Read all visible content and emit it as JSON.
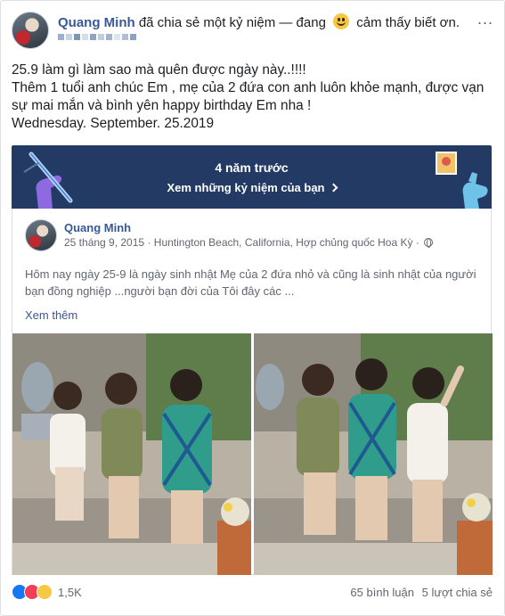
{
  "post": {
    "author": "Quang Minh",
    "action": "đã chia sẻ một kỷ niệm — đang",
    "feeling": "cảm thấy biết ơn.",
    "emoji_icon": "smile-emoji-icon",
    "more_icon": "...",
    "text_lines": [
      "25.9 làm gì làm sao mà quên được ngày này..!!!!",
      "Thêm 1 tuổi anh chúc Em , mẹ của 2 đứa con anh luôn khỏe mạnh, được vạn",
      "sự mai mắn và bình yên happy birthday Em nha !",
      "Wednesday. September. 25.2019"
    ]
  },
  "memory": {
    "title": "4 năm trước",
    "link": "Xem những kỷ niệm của bạn",
    "background": "#233a64"
  },
  "shared": {
    "author": "Quang Minh",
    "date": "25 tháng 9, 2015",
    "location": "Huntington Beach, California, Hợp chủng quốc Hoa Kỳ",
    "caption": "Hôm nay ngày 25-9 là ngày sinh nhật Mẹ của 2 đứa nhỏ và cũng là sinh nhật của người bạn đồng nghiệp ...người bạn đời của Tôi đây các ...",
    "see_more": "Xem thêm"
  },
  "footer": {
    "reaction_count": "1,5K",
    "comments": "65 bình luận",
    "shares": "5 lượt chia sẻ"
  },
  "colors": {
    "link": "#385898",
    "muted": "#606770",
    "like": "#1877f2",
    "love": "#f33e58",
    "sad": "#f7c844"
  }
}
